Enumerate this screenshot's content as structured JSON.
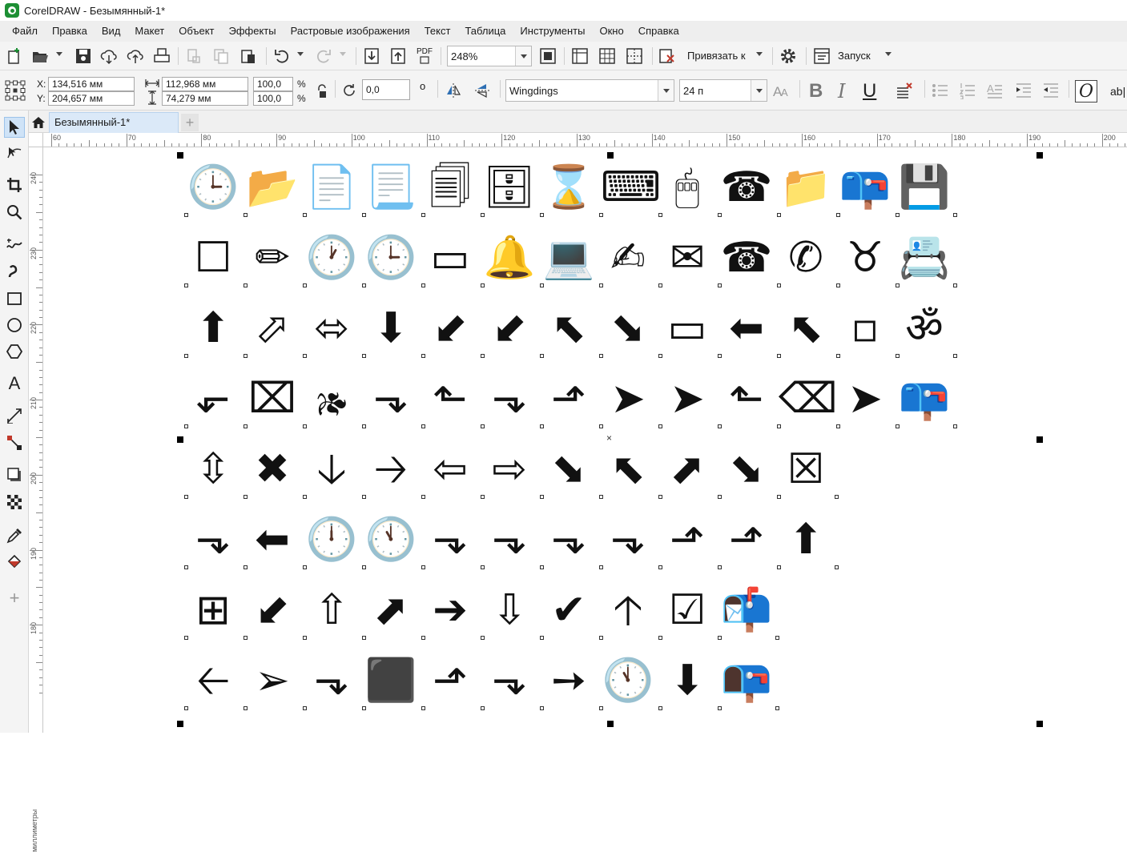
{
  "window": {
    "title": "CorelDRAW - Безымянный-1*"
  },
  "menu": [
    "Файл",
    "Правка",
    "Вид",
    "Макет",
    "Объект",
    "Эффекты",
    "Растровые изображения",
    "Текст",
    "Таблица",
    "Инструменты",
    "Окно",
    "Справка"
  ],
  "toolbar": {
    "zoom": "248%",
    "snap_label": "Привязать к",
    "launch_label": "Запуск",
    "pdf_label": "PDF",
    "icons": [
      "new-document-icon",
      "open-icon",
      "save-icon",
      "import-cloud-icon",
      "export-cloud-icon",
      "print-icon",
      "undo-icon",
      "redo-icon",
      "import-icon",
      "export-icon",
      "publish-pdf-icon",
      "full-screen-icon",
      "rulers-icon",
      "grid-icon",
      "guidelines-icon",
      "snap-off-icon",
      "options-gear-icon",
      "application-launcher-icon"
    ]
  },
  "property_bar": {
    "x_label": "X:",
    "x_value": "134,516 мм",
    "y_label": "Y:",
    "y_value": "204,657 мм",
    "width_value": "112,968 мм",
    "height_value": "74,279 мм",
    "scale_x": "100,0",
    "scale_y": "100,0",
    "percent": "%",
    "rotation": "0,0",
    "degree_symbol": "o",
    "font_name": "Wingdings",
    "font_size": "24 п",
    "bold": "B",
    "italic": "I",
    "underline": "U",
    "overflow_label": "ab|"
  },
  "tabs": {
    "document": "Безымянный-1*",
    "add": "+"
  },
  "ruler": {
    "h_labels": [
      "60",
      "70",
      "80",
      "90",
      "100",
      "110",
      "120",
      "130",
      "140",
      "150",
      "160",
      "170",
      "180",
      "190",
      "200"
    ],
    "v_labels": [
      "240",
      "230",
      "220",
      "210",
      "200",
      "190",
      "180"
    ],
    "unit": "миллиметры"
  },
  "canvas": {
    "rows": [
      "🕒📂📄📃🗐🗄⌛⌨🖱☎📁📪💾",
      "☐✏🕐🕒▭🔔💻✍✉☎✆♉📇",
      "⬆⬀⬄⬇⬋⬋⬉⬊▭⬅⬉▫ॐ",
      "⬐⌧🙕⬎⬑⬎⬏➤➤⬑⌫➤📪",
      "⇳✖🡣🡢⇦⇨⬊⬉⬈⬊☒",
      "⬎⬅🕛🕚⬎⬎⬎⬎⬏⬏⬆",
      "⊞⬋⇧⬈➔⇩✔🡡☑📬",
      "🡠➢⬎⬛⬏⬎➙🕚⬇📭"
    ]
  }
}
